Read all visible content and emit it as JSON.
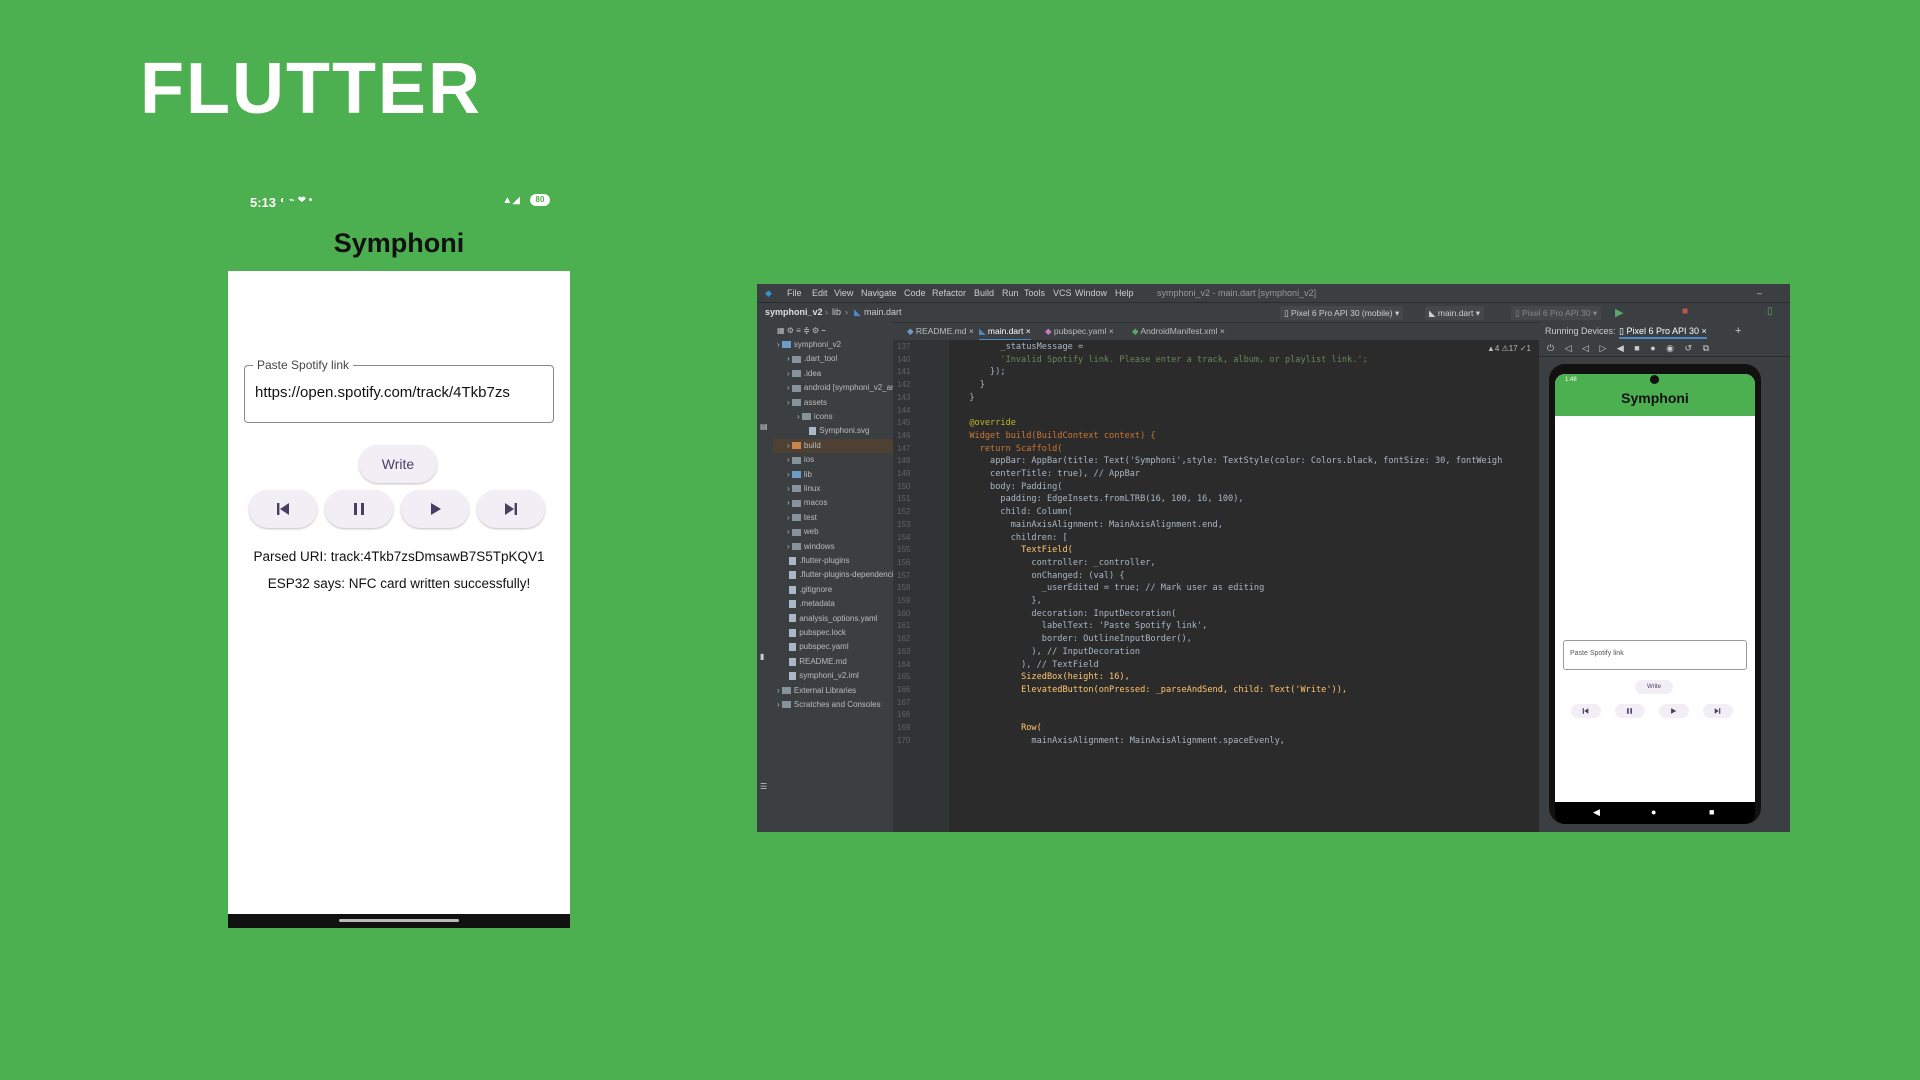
{
  "slide": {
    "title": "FLUTTER"
  },
  "phone": {
    "status": {
      "time": "5:13",
      "battery": "80"
    },
    "app_title": "Symphoni",
    "field_label": "Paste Spotify link",
    "field_value": "https://open.spotify.com/track/4Tkb7zs",
    "write_label": "Write",
    "parsed_uri": "Parsed URI: track:4Tkb7zsDmsawB7S5TpKQV1",
    "esp_message": "ESP32 says: NFC card written successfully!"
  },
  "ide": {
    "menu": [
      "File",
      "Edit",
      "View",
      "Navigate",
      "Code",
      "Refactor",
      "Build",
      "Run",
      "Tools",
      "VCS",
      "Window",
      "Help"
    ],
    "window_title": "symphoni_v2 - main.dart [symphoni_v2]",
    "breadcrumb": [
      "symphoni_v2",
      "lib",
      "main.dart"
    ],
    "device_selector": "Pixel 6 Pro API 30 (mobile)",
    "run_config": "main.dart",
    "device_secondary": "Pixel 6 Pro API 30",
    "tabs": [
      "README.md",
      "main.dart",
      "pubspec.yaml",
      "AndroidManifest.xml"
    ],
    "inspections": "▲4  ⚠17  ✓1",
    "project_tree": [
      "symphoni_v2",
      ".dart_tool",
      ".idea",
      "android [symphoni_v2_android]",
      "assets",
      "icons",
      "Symphoni.svg",
      "build",
      "ios",
      "lib",
      "linux",
      "macos",
      "test",
      "web",
      "windows",
      ".flutter-plugins",
      ".flutter-plugins-dependencies",
      ".gitignore",
      ".metadata",
      "analysis_options.yaml",
      "pubspec.lock",
      "pubspec.yaml",
      "README.md",
      "symphoni_v2.iml",
      "External Libraries",
      "Scratches and Consoles"
    ],
    "code_lines": [
      "        _statusMessage =",
      "        'Invalid Spotify link. Please enter a track, album, or playlist link.';",
      "      });",
      "    }",
      "  }",
      "",
      "  @override",
      "  Widget build(BuildContext context) {",
      "    return Scaffold(",
      "      appBar: AppBar(title: Text('Symphoni',style: TextStyle(color: Colors.black, fontSize: 30, fontWeigh",
      "      centerTitle: true), // AppBar",
      "      body: Padding(",
      "        padding: EdgeInsets.fromLTRB(16, 100, 16, 100),",
      "        child: Column(",
      "          mainAxisAlignment: MainAxisAlignment.end,",
      "          children: [",
      "            TextField(",
      "              controller: _controller,",
      "              onChanged: (val) {",
      "                _userEdited = true; // Mark user as editing",
      "              },",
      "              decoration: InputDecoration(",
      "                labelText: 'Paste Spotify link',",
      "                border: OutlineInputBorder(),",
      "              ), // InputDecoration",
      "            ), // TextField",
      "            SizedBox(height: 16),",
      "            ElevatedButton(onPressed: _parseAndSend, child: Text('Write')),",
      "",
      "",
      "            Row(",
      "              mainAxisAlignment: MainAxisAlignment.spaceEvenly,"
    ],
    "line_numbers": [
      "137",
      "140",
      "141",
      "142",
      "143",
      "144",
      "145",
      "146",
      "147",
      "148",
      "149",
      "150",
      "151",
      "152",
      "153",
      "154",
      "155",
      "156",
      "157",
      "158",
      "159",
      "160",
      "161",
      "162",
      "163",
      "164",
      "165",
      "166",
      "167",
      "168",
      "169",
      "170"
    ],
    "running_devices_label": "Running Devices:",
    "running_device_tab": "Pixel 6 Pro API 30",
    "mini_phone": {
      "time": "1:48",
      "app_title": "Symphoni",
      "field_label": "Paste Spotify link",
      "write_label": "Write"
    }
  }
}
